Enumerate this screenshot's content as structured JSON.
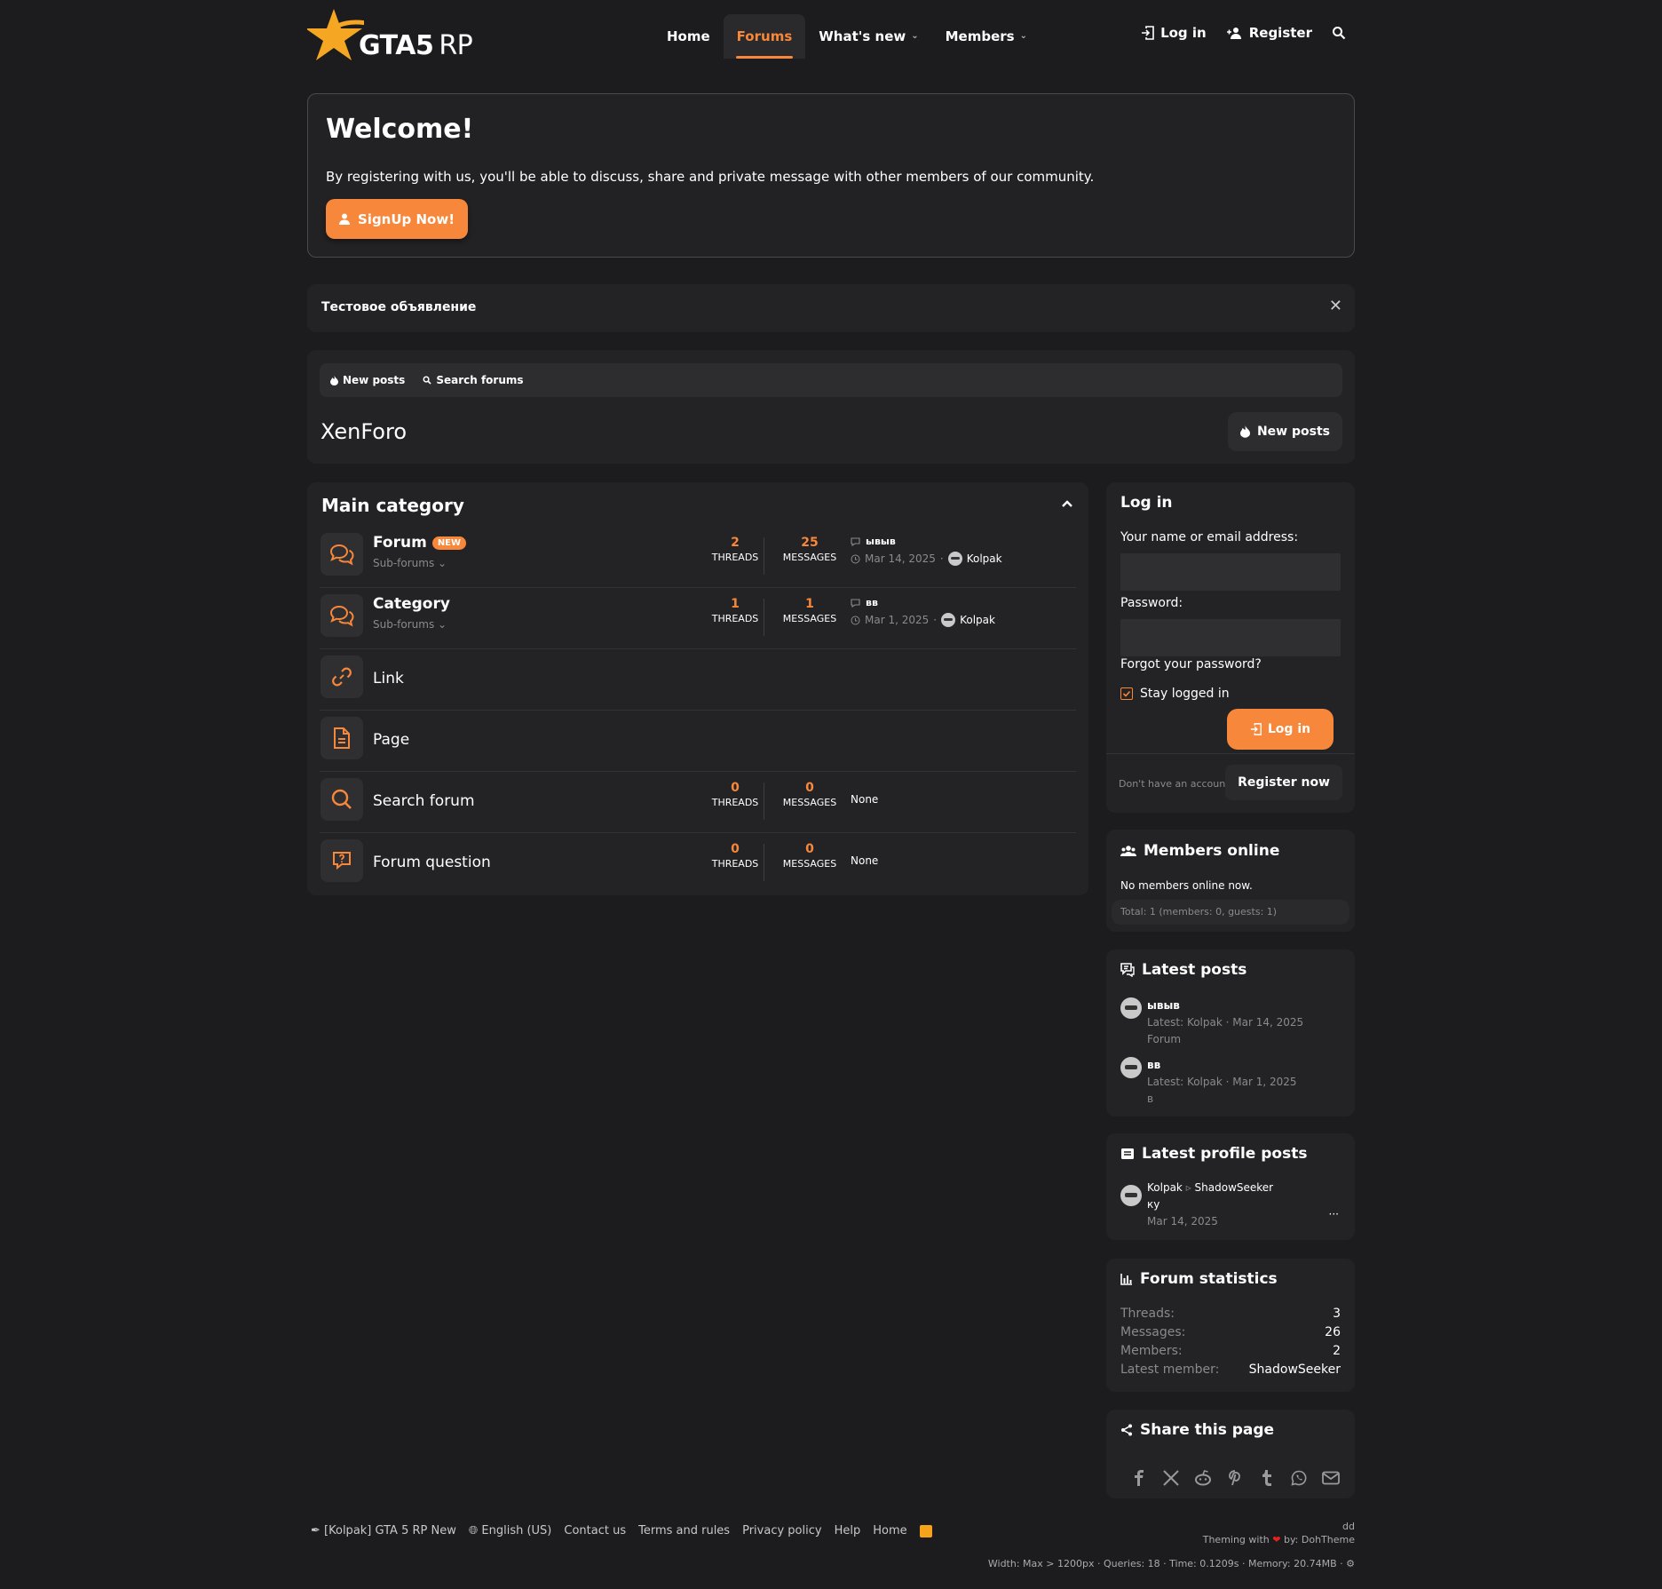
{
  "brand": {
    "logo_text_bold": "GTA5",
    "logo_text_light": "RP",
    "accent": "#f7873a"
  },
  "nav": {
    "home": "Home",
    "forums": "Forums",
    "whats_new": "What's new",
    "members": "Members"
  },
  "account": {
    "login": "Log in",
    "register": "Register"
  },
  "welcome": {
    "title": "Welcome!",
    "text": "By registering with us, you'll be able to discuss, share and private message with other members of our community.",
    "button": "SignUp Now!"
  },
  "notice": {
    "text": "Тестовое объявление"
  },
  "subnav": {
    "new_posts": "New posts",
    "search_forums": "Search forums"
  },
  "page": {
    "title": "XenForo",
    "new_posts_button": "New posts"
  },
  "category": {
    "title": "Main category",
    "nodes": [
      {
        "title": "Forum",
        "badge": "NEW",
        "sub": "Sub-forums",
        "threads": "2",
        "messages": "25",
        "threads_label": "THREADS",
        "messages_label": "MESSAGES",
        "last_title": "ывыв",
        "last_date": "Mar 14, 2025",
        "last_user": "Kolpak"
      },
      {
        "title": "Category",
        "sub": "Sub-forums",
        "threads": "1",
        "messages": "1",
        "threads_label": "THREADS",
        "messages_label": "MESSAGES",
        "last_title": "вв",
        "last_date": "Mar 1, 2025",
        "last_user": "Kolpak"
      },
      {
        "title": "Link"
      },
      {
        "title": "Page"
      },
      {
        "title": "Search forum",
        "threads": "0",
        "messages": "0",
        "threads_label": "THREADS",
        "messages_label": "MESSAGES",
        "last_none": "None"
      },
      {
        "title": "Forum question",
        "threads": "0",
        "messages": "0",
        "threads_label": "THREADS",
        "messages_label": "MESSAGES",
        "last_none": "None"
      }
    ]
  },
  "login_box": {
    "title": "Log in",
    "name_label": "Your name or email address:",
    "password_label": "Password:",
    "forgot": "Forgot your password?",
    "stay": "Stay logged in",
    "button": "Log in",
    "dont_have": "Don't have an account?",
    "register_now": "Register now"
  },
  "members_online": {
    "title": "Members online",
    "none": "No members online now.",
    "total": "Total: 1 (members: 0, guests: 1)"
  },
  "latest_posts": {
    "title": "Latest posts",
    "items": [
      {
        "title": "ывыв",
        "meta": "Latest: Kolpak · Mar 14, 2025",
        "forum": "Forum"
      },
      {
        "title": "вв",
        "meta": "Latest: Kolpak · Mar 1, 2025",
        "forum": "в"
      }
    ]
  },
  "latest_profile_posts": {
    "title": "Latest profile posts",
    "from": "Kolpak",
    "to": "ShadowSeeker",
    "text": "ку",
    "date": "Mar 14, 2025",
    "more": "···"
  },
  "forum_statistics": {
    "title": "Forum statistics",
    "rows": [
      {
        "k": "Threads:",
        "v": "3"
      },
      {
        "k": "Messages:",
        "v": "26"
      },
      {
        "k": "Members:",
        "v": "2"
      },
      {
        "k": "Latest member:",
        "v": "ShadowSeeker"
      }
    ]
  },
  "share": {
    "title": "Share this page",
    "icons": [
      "facebook-icon",
      "x-icon",
      "reddit-icon",
      "pinterest-icon",
      "tumblr-icon",
      "whatsapp-icon",
      "email-icon"
    ]
  },
  "footer": {
    "style": "[Kolpak] GTA 5 RP New",
    "language": "English (US)",
    "contact": "Contact us",
    "terms": "Terms and rules",
    "privacy": "Privacy policy",
    "help": "Help",
    "home": "Home",
    "dd": "dd",
    "theming_pre": "Theming with",
    "theming_post": "by: DohTheme",
    "debug": "Width: Max > 1200px · Queries: 18 · Time: 0.1209s · Memory: 20.74MB ·"
  }
}
